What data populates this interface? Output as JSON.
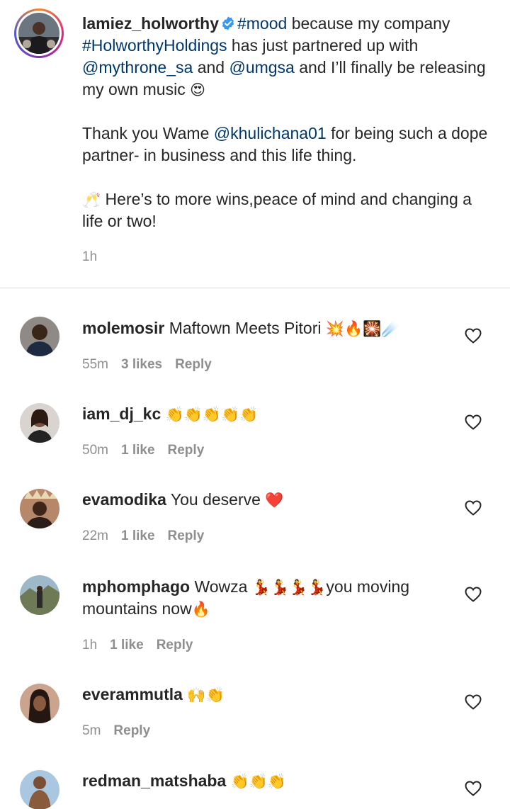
{
  "post": {
    "username": "lamiez_holworthy",
    "caption_parts": {
      "hashtag_mood": "#mood",
      "t1": " because my company ",
      "hashtag_company": "#HolworthyHoldings",
      "t2": " has just partnered up with ",
      "mention1": "@mythrone_sa",
      "t3": " and ",
      "mention2": "@umgsa",
      "t4": " and I’ll finally be releasing my own music ",
      "emoji1": "😍",
      "p2a": "Thank you Wame ",
      "mention3": "@khulichana01",
      "p2b": " for being such a dope partner- in business and this life thing.",
      "emoji2": "🥂",
      "p3": " Here’s to more wins,peace of mind and changing a life or two!"
    },
    "time": "1h"
  },
  "comments": [
    {
      "username": "molemosir",
      "text": "Maftown Meets Pitori ",
      "emoji": "💥🔥🎇☄️",
      "time": "55m",
      "likes": "3 likes",
      "reply": "Reply"
    },
    {
      "username": "iam_dj_kc",
      "text": "",
      "emoji": "👏👏👏👏👏",
      "time": "50m",
      "likes": "1 like",
      "reply": "Reply"
    },
    {
      "username": "evamodika",
      "text": "You deserve ",
      "emoji": "❤️",
      "time": "22m",
      "likes": "1 like",
      "reply": "Reply"
    },
    {
      "username": "mphomphago",
      "text": "Wowza ",
      "emoji": "💃💃💃💃",
      "text2": "you moving mountains now",
      "emoji2": "🔥",
      "time": "1h",
      "likes": "1 like",
      "reply": "Reply"
    },
    {
      "username": "everammutla",
      "text": "",
      "emoji": "🙌👏",
      "time": "5m",
      "likes": "",
      "reply": "Reply"
    },
    {
      "username": "redman_matshaba",
      "text": "",
      "emoji": "👏👏👏",
      "time": "",
      "likes": "",
      "reply": ""
    }
  ],
  "colors": {
    "link": "#00376b",
    "muted": "#8e8e8e",
    "verified": "#3897f0"
  }
}
